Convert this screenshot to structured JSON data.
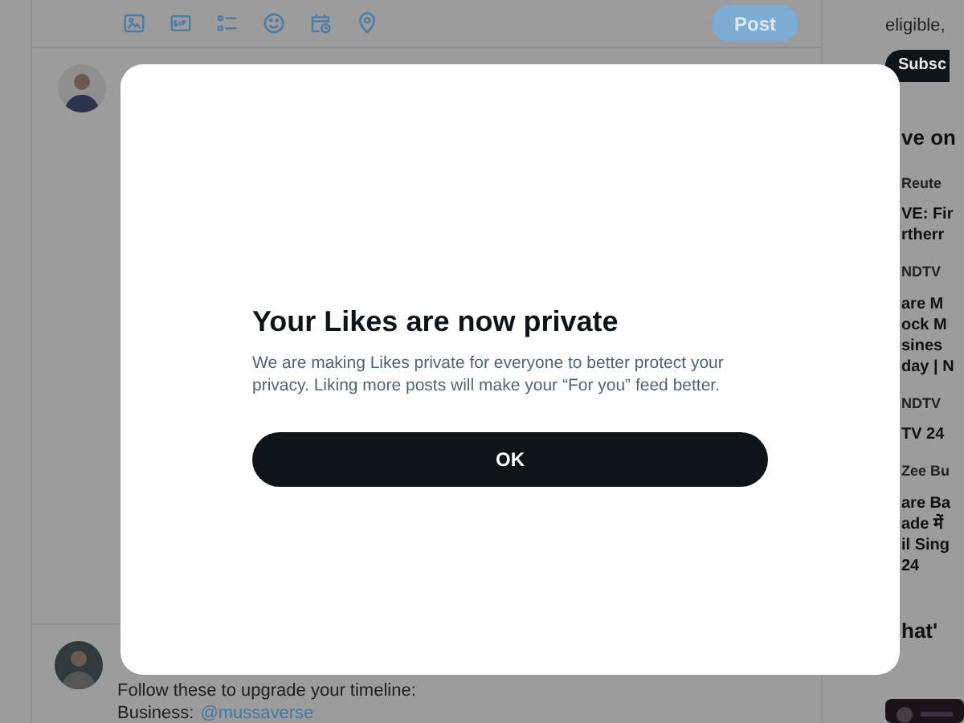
{
  "composer": {
    "post_button": "Post"
  },
  "sidebar": {
    "premium_text": "eligible,",
    "premium_button": "Subsc",
    "live_heading": "ve on",
    "news": [
      {
        "source": "Reute",
        "lines": [
          "VE: Fir",
          "rtherr"
        ]
      },
      {
        "source": "NDTV",
        "lines": [
          "are M",
          "ock M",
          "sines",
          "day | N"
        ]
      },
      {
        "source": "NDTV",
        "lines": [
          "TV 24"
        ]
      },
      {
        "source": "Zee Bu",
        "lines": [
          "are Ba",
          "ade में",
          "il Sing",
          "24"
        ]
      }
    ],
    "next_heading": "hat'"
  },
  "post": {
    "text": "Follow these to upgrade your timeline:",
    "label": "Business:",
    "link": "@mussaverse"
  },
  "dialog": {
    "title": "Your Likes are now private",
    "body": "We are making Likes private for everyone to better protect your privacy. Liking more posts will make your “For you” feed better.",
    "button": "OK"
  }
}
